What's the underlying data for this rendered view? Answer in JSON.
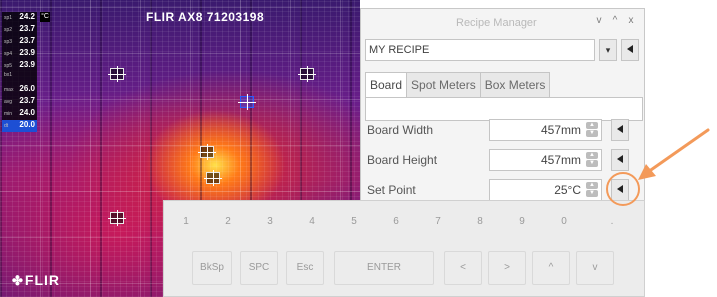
{
  "camera": {
    "title": "FLIR AX8 71203198",
    "unit": "°C",
    "brand": "FLIR",
    "readings": [
      {
        "label": "sp1",
        "value": "24.2",
        "highlight": false
      },
      {
        "label": "sp2",
        "value": "23.7",
        "highlight": false
      },
      {
        "label": "sp3",
        "value": "23.7",
        "highlight": false
      },
      {
        "label": "sp4",
        "value": "23.9",
        "highlight": false
      },
      {
        "label": "sp5",
        "value": "23.9",
        "highlight": false
      },
      {
        "label": "bx1",
        "value": "",
        "highlight": false
      },
      {
        "label": "max",
        "value": "26.0",
        "highlight": false
      },
      {
        "label": "avg",
        "value": "23.7",
        "highlight": false
      },
      {
        "label": "min",
        "value": "24.0",
        "highlight": false
      },
      {
        "label": "dt",
        "value": "20.0",
        "highlight": true
      }
    ],
    "spot_markers": [
      {
        "label": "sp1"
      },
      {
        "label": "sp2"
      },
      {
        "label": "sp3"
      },
      {
        "label": "sp4"
      },
      {
        "label": "sp5"
      },
      {
        "label": "sp6"
      }
    ]
  },
  "recipe_manager": {
    "title": "Recipe Manager",
    "window_controls": [
      "v",
      "^",
      "x"
    ],
    "recipe_name": "MY RECIPE",
    "dropdown_icon": "dropdown-icon",
    "load_icon": "play-left-icon",
    "tabs": [
      {
        "label": "Board",
        "active": true
      },
      {
        "label": "Spot Meters",
        "active": false
      },
      {
        "label": "Box Meters",
        "active": false
      }
    ],
    "params": [
      {
        "label": "Board Width",
        "value": "457mm"
      },
      {
        "label": "Board Height",
        "value": "457mm"
      },
      {
        "label": "Set Point",
        "value": "25°C"
      }
    ]
  },
  "keyboard": {
    "digits": [
      "1",
      "2",
      "3",
      "4",
      "5",
      "6",
      "7",
      "8",
      "9",
      "0",
      "."
    ],
    "bottom_keys": [
      "BkSp",
      "SPC",
      "Esc",
      "ENTER",
      "<",
      ">",
      "^",
      "v"
    ]
  },
  "annotation": {
    "color": "#f39a5a",
    "highlight": "set-point-send-button"
  }
}
